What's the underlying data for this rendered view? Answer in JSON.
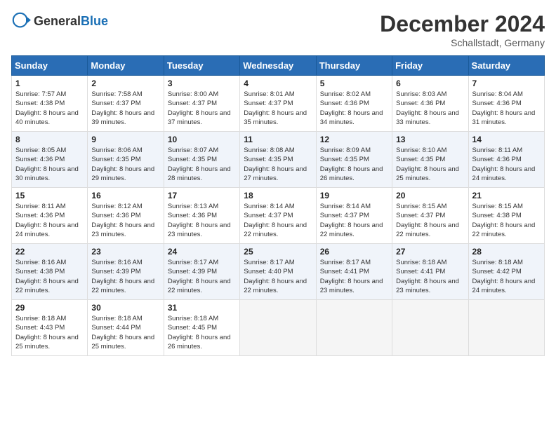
{
  "header": {
    "logo_general": "General",
    "logo_blue": "Blue",
    "month": "December 2024",
    "location": "Schallstadt, Germany"
  },
  "weekdays": [
    "Sunday",
    "Monday",
    "Tuesday",
    "Wednesday",
    "Thursday",
    "Friday",
    "Saturday"
  ],
  "weeks": [
    [
      {
        "day": "1",
        "sunrise": "7:57 AM",
        "sunset": "4:38 PM",
        "daylight": "8 hours and 40 minutes."
      },
      {
        "day": "2",
        "sunrise": "7:58 AM",
        "sunset": "4:37 PM",
        "daylight": "8 hours and 39 minutes."
      },
      {
        "day": "3",
        "sunrise": "8:00 AM",
        "sunset": "4:37 PM",
        "daylight": "8 hours and 37 minutes."
      },
      {
        "day": "4",
        "sunrise": "8:01 AM",
        "sunset": "4:37 PM",
        "daylight": "8 hours and 35 minutes."
      },
      {
        "day": "5",
        "sunrise": "8:02 AM",
        "sunset": "4:36 PM",
        "daylight": "8 hours and 34 minutes."
      },
      {
        "day": "6",
        "sunrise": "8:03 AM",
        "sunset": "4:36 PM",
        "daylight": "8 hours and 33 minutes."
      },
      {
        "day": "7",
        "sunrise": "8:04 AM",
        "sunset": "4:36 PM",
        "daylight": "8 hours and 31 minutes."
      }
    ],
    [
      {
        "day": "8",
        "sunrise": "8:05 AM",
        "sunset": "4:36 PM",
        "daylight": "8 hours and 30 minutes."
      },
      {
        "day": "9",
        "sunrise": "8:06 AM",
        "sunset": "4:35 PM",
        "daylight": "8 hours and 29 minutes."
      },
      {
        "day": "10",
        "sunrise": "8:07 AM",
        "sunset": "4:35 PM",
        "daylight": "8 hours and 28 minutes."
      },
      {
        "day": "11",
        "sunrise": "8:08 AM",
        "sunset": "4:35 PM",
        "daylight": "8 hours and 27 minutes."
      },
      {
        "day": "12",
        "sunrise": "8:09 AM",
        "sunset": "4:35 PM",
        "daylight": "8 hours and 26 minutes."
      },
      {
        "day": "13",
        "sunrise": "8:10 AM",
        "sunset": "4:35 PM",
        "daylight": "8 hours and 25 minutes."
      },
      {
        "day": "14",
        "sunrise": "8:11 AM",
        "sunset": "4:36 PM",
        "daylight": "8 hours and 24 minutes."
      }
    ],
    [
      {
        "day": "15",
        "sunrise": "8:11 AM",
        "sunset": "4:36 PM",
        "daylight": "8 hours and 24 minutes."
      },
      {
        "day": "16",
        "sunrise": "8:12 AM",
        "sunset": "4:36 PM",
        "daylight": "8 hours and 23 minutes."
      },
      {
        "day": "17",
        "sunrise": "8:13 AM",
        "sunset": "4:36 PM",
        "daylight": "8 hours and 23 minutes."
      },
      {
        "day": "18",
        "sunrise": "8:14 AM",
        "sunset": "4:37 PM",
        "daylight": "8 hours and 22 minutes."
      },
      {
        "day": "19",
        "sunrise": "8:14 AM",
        "sunset": "4:37 PM",
        "daylight": "8 hours and 22 minutes."
      },
      {
        "day": "20",
        "sunrise": "8:15 AM",
        "sunset": "4:37 PM",
        "daylight": "8 hours and 22 minutes."
      },
      {
        "day": "21",
        "sunrise": "8:15 AM",
        "sunset": "4:38 PM",
        "daylight": "8 hours and 22 minutes."
      }
    ],
    [
      {
        "day": "22",
        "sunrise": "8:16 AM",
        "sunset": "4:38 PM",
        "daylight": "8 hours and 22 minutes."
      },
      {
        "day": "23",
        "sunrise": "8:16 AM",
        "sunset": "4:39 PM",
        "daylight": "8 hours and 22 minutes."
      },
      {
        "day": "24",
        "sunrise": "8:17 AM",
        "sunset": "4:39 PM",
        "daylight": "8 hours and 22 minutes."
      },
      {
        "day": "25",
        "sunrise": "8:17 AM",
        "sunset": "4:40 PM",
        "daylight": "8 hours and 22 minutes."
      },
      {
        "day": "26",
        "sunrise": "8:17 AM",
        "sunset": "4:41 PM",
        "daylight": "8 hours and 23 minutes."
      },
      {
        "day": "27",
        "sunrise": "8:18 AM",
        "sunset": "4:41 PM",
        "daylight": "8 hours and 23 minutes."
      },
      {
        "day": "28",
        "sunrise": "8:18 AM",
        "sunset": "4:42 PM",
        "daylight": "8 hours and 24 minutes."
      }
    ],
    [
      {
        "day": "29",
        "sunrise": "8:18 AM",
        "sunset": "4:43 PM",
        "daylight": "8 hours and 25 minutes."
      },
      {
        "day": "30",
        "sunrise": "8:18 AM",
        "sunset": "4:44 PM",
        "daylight": "8 hours and 25 minutes."
      },
      {
        "day": "31",
        "sunrise": "8:18 AM",
        "sunset": "4:45 PM",
        "daylight": "8 hours and 26 minutes."
      },
      null,
      null,
      null,
      null
    ]
  ]
}
